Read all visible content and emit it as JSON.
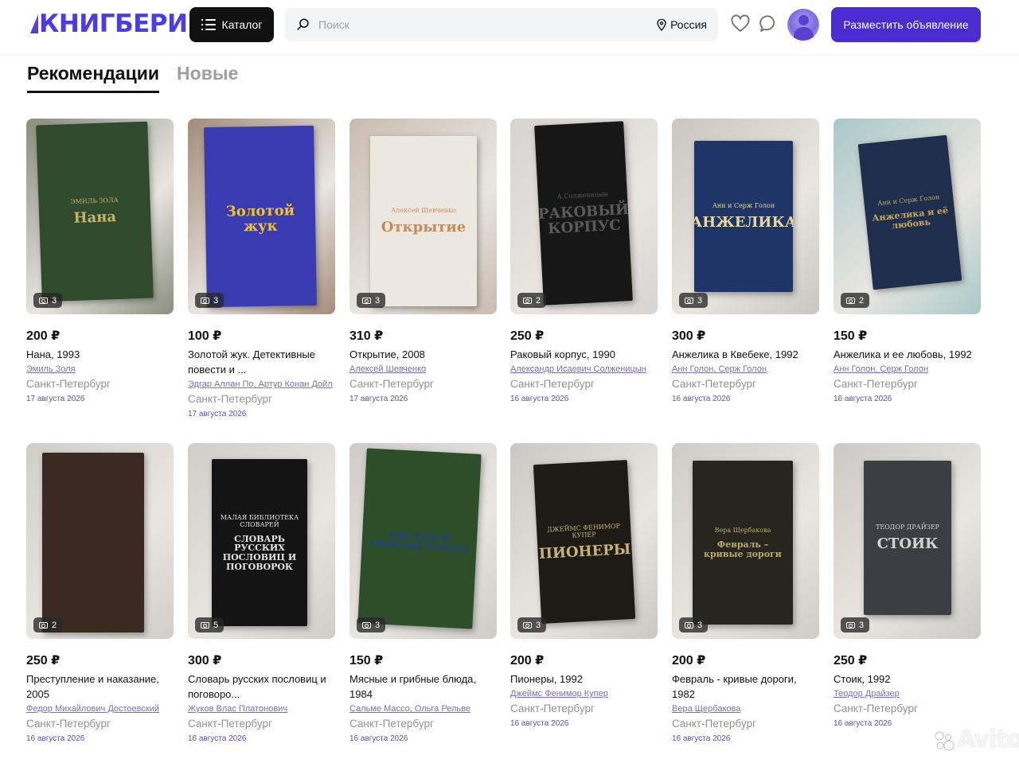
{
  "header": {
    "logo": "КНИГБЕРИ",
    "catalog_label": "Каталог",
    "search_placeholder": "Поиск",
    "region": "Россия",
    "post_button": "Разместить объявление"
  },
  "tabs": [
    {
      "label": "Рекомендации",
      "active": true
    },
    {
      "label": "Новые",
      "active": false
    }
  ],
  "listings": [
    {
      "price": "200 ₽",
      "title": "Нана, 1993",
      "author": "Эмиль Золя",
      "city": "Санкт-Петербург",
      "date": "17 августа 2026",
      "photos": "3",
      "cover": {
        "bg": "#2f4a2c",
        "text": "#c7b36b",
        "label": "Нана",
        "author": "ЭМИЛЬ ЗОЛА",
        "scene": "#8a8d7e"
      }
    },
    {
      "price": "100 ₽",
      "title": "Золотой жук. Детективные повести и ...",
      "author": "Эдгар Аллан По, Артур Конан Дойл",
      "city": "Санкт-Петербург",
      "date": "17 августа 2026",
      "photos": "3",
      "cover": {
        "bg": "#3a3bb0",
        "text": "#f3c424",
        "label": "Золотой жук",
        "author": "",
        "scene": "#a48b7a"
      }
    },
    {
      "price": "310 ₽",
      "title": "Открытие, 2008",
      "author": "Алексей Шевченко",
      "city": "Санкт-Петербург",
      "date": "17 августа 2026",
      "photos": "3",
      "cover": {
        "bg": "#ece8e0",
        "text": "#c78a5a",
        "label": "Открытие",
        "author": "Алексей Шевченко",
        "scene": "#c8bcb0"
      }
    },
    {
      "price": "250 ₽",
      "title": "Раковый корпус, 1990",
      "author": "Александр Исаевич Солженицын",
      "city": "Санкт-Петербург",
      "date": "16 августа 2026",
      "photos": "2",
      "cover": {
        "bg": "#171717",
        "text": "#5a5a5a",
        "label": "РАКОВЫЙ КОРПУС",
        "author": "А.Солженицын",
        "scene": "#d6d3d1"
      }
    },
    {
      "price": "300 ₽",
      "title": "Анжелика в Квебеке, 1992",
      "author": "Анн Голон, Серж Голон",
      "city": "Санкт-Петербург",
      "date": "16 августа 2026",
      "photos": "3",
      "cover": {
        "bg": "#1f3468",
        "text": "#e8d79a",
        "label": "АНЖЕЛИКА",
        "author": "Анн и Серж Голон",
        "scene": "#c9c6c2"
      }
    },
    {
      "price": "150 ₽",
      "title": "Анжелика и ее любовь, 1992",
      "author": "Анн Голон, Серж Голон",
      "city": "Санкт-Петербург",
      "date": "16 августа 2026",
      "photos": "2",
      "cover": {
        "bg": "#1f2e4d",
        "text": "#c9a85a",
        "label": "Анжелика и её любовь",
        "author": "Анн и Серж Голон",
        "scene": "#a9c8c9"
      }
    },
    {
      "price": "250 ₽",
      "title": "Преступление и наказание, 2005",
      "author": "Федор Михайлович Достоевский",
      "city": "Санкт-Петербург",
      "date": "16 августа 2026",
      "photos": "2",
      "cover": {
        "bg": "#3b2a22",
        "text": "#e8e0d0",
        "label": "",
        "author": "",
        "scene": "#d1cec8"
      }
    },
    {
      "price": "300 ₽",
      "title": "Словарь русских пословиц и поговоро...",
      "author": "Жуков Влас Платонович",
      "city": "Санкт-Петербург",
      "date": "16 августа 2026",
      "photos": "5",
      "cover": {
        "bg": "#141414",
        "text": "#e6e6e6",
        "label": "СЛОВАРЬ РУССКИХ ПОСЛОВИЦ И ПОГОВОРОК",
        "author": "МАЛАЯ БИБЛИОТЕКА СЛОВАРЕЙ",
        "scene": "#d0cdc8"
      }
    },
    {
      "price": "150 ₽",
      "title": "Мясные и грибные блюда, 1984",
      "author": "Сальме Массо, Ольга Рельве",
      "city": "Санкт-Петербург",
      "date": "16 августа 2026",
      "photos": "3",
      "cover": {
        "bg": "#2c4f2a",
        "text": "#233e84",
        "label": "МЯСНЫЕ И ГРИБНЫЕ БЛЮДА",
        "author": "",
        "scene": "#cfcbc5"
      }
    },
    {
      "price": "200 ₽",
      "title": "Пионеры, 1992",
      "author": "Джеймс Фенимор Купер",
      "city": "Санкт-Петербург",
      "date": "16 августа 2026",
      "photos": "3",
      "cover": {
        "bg": "#1e1b16",
        "text": "#c8b27a",
        "label": "ПИОНЕРЫ",
        "author": "ДЖЕЙМС ФЕНИМОР КУПЕР",
        "scene": "#cbc8c3"
      }
    },
    {
      "price": "200 ₽",
      "title": "Февраль - кривые дороги, 1982",
      "author": "Вера Щербакова",
      "city": "Санкт-Петербург",
      "date": "16 августа 2026",
      "photos": "3",
      "cover": {
        "bg": "#26261f",
        "text": "#bba96a",
        "label": "Февраль – кривые дороги",
        "author": "Вера Щербакова",
        "scene": "#cfccc6"
      }
    },
    {
      "price": "250 ₽",
      "title": "Стоик, 1992",
      "author": "Теодор Драйзер",
      "city": "Санкт-Петербург",
      "date": "16 августа 2026",
      "photos": "3",
      "cover": {
        "bg": "#3b3f44",
        "text": "#d3d3d3",
        "label": "СТОИК",
        "author": "ТЕОДОР ДРАЙЗЕР",
        "scene": "#cbc9c5"
      }
    }
  ],
  "watermark": "Avito"
}
